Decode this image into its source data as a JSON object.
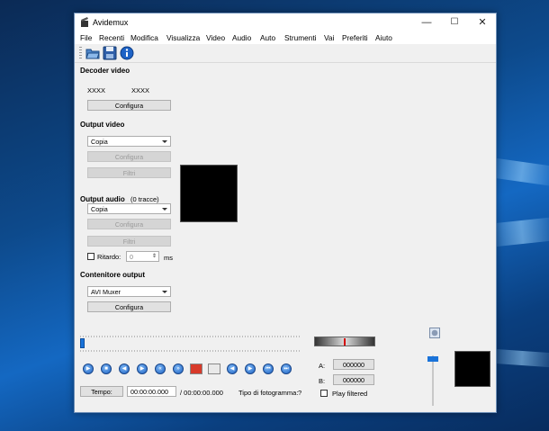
{
  "window": {
    "title": "Avidemux",
    "minimize": "—",
    "maximize": "☐",
    "close": "✕"
  },
  "menu": [
    "File",
    "Recenti",
    "Modifica",
    "Visualizza",
    "Video",
    "Audio",
    "Auto",
    "Strumenti",
    "Vai",
    "Preferiti",
    "Aiuto"
  ],
  "decoder": {
    "heading": "Decoder video",
    "codec1": "XXXX",
    "codec2": "XXXX",
    "configure": "Configura"
  },
  "video_output": {
    "heading": "Output video",
    "selected": "Copia",
    "configure": "Configura",
    "filters": "Filtri"
  },
  "audio_output": {
    "heading": "Output audio",
    "tracks": "(0 tracce)",
    "selected": "Copia",
    "configure": "Configura",
    "filters": "Filtri",
    "delay_label": "Ritardo:",
    "delay_value": "0",
    "delay_unit": "ms"
  },
  "container": {
    "heading": "Contenitore output",
    "selected": "AVI Muxer",
    "configure": "Configura"
  },
  "markers": {
    "a_label": "A:",
    "a_value": "000000",
    "b_label": "B:",
    "b_value": "000000",
    "play_filtered": "Play filtered"
  },
  "time": {
    "button": "Tempo:",
    "current": "00:00:00.000",
    "total": "/ 00:00:00.000",
    "frame_type_label": "Tipo di fotogramma:",
    "frame_type_value": "?"
  },
  "colors": {
    "accent": "#1a73d9",
    "marker": "#d40000"
  }
}
